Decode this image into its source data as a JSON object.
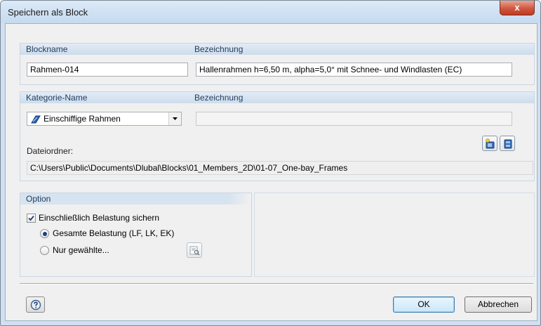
{
  "window": {
    "title": "Speichern als Block",
    "close_label": "x"
  },
  "block": {
    "name_label": "Blockname",
    "name_value": "Rahmen-014",
    "description_label": "Bezeichnung",
    "description_value": "Hallenrahmen h=6,50 m, alpha=5,0° mit Schnee- und Windlasten (EC)"
  },
  "category": {
    "name_label": "Kategorie-Name",
    "selected": "Einschiffige Rahmen",
    "description_label": "Bezeichnung",
    "description_value": "",
    "folder_label": "Dateiordner:",
    "folder_path": "C:\\Users\\Public\\Documents\\Dlubal\\Blocks\\01_Members_2D\\01-07_One-bay_Frames"
  },
  "option": {
    "header": "Option",
    "include_loads_label": "Einschließlich Belastung sichern",
    "include_loads_checked": true,
    "all_loads_label": "Gesamte Belastung (LF, LK, EK)",
    "selected_loads_label": "Nur gewählte...",
    "selected_radio": "all"
  },
  "footer": {
    "ok_label": "OK",
    "cancel_label": "Abbrechen"
  }
}
